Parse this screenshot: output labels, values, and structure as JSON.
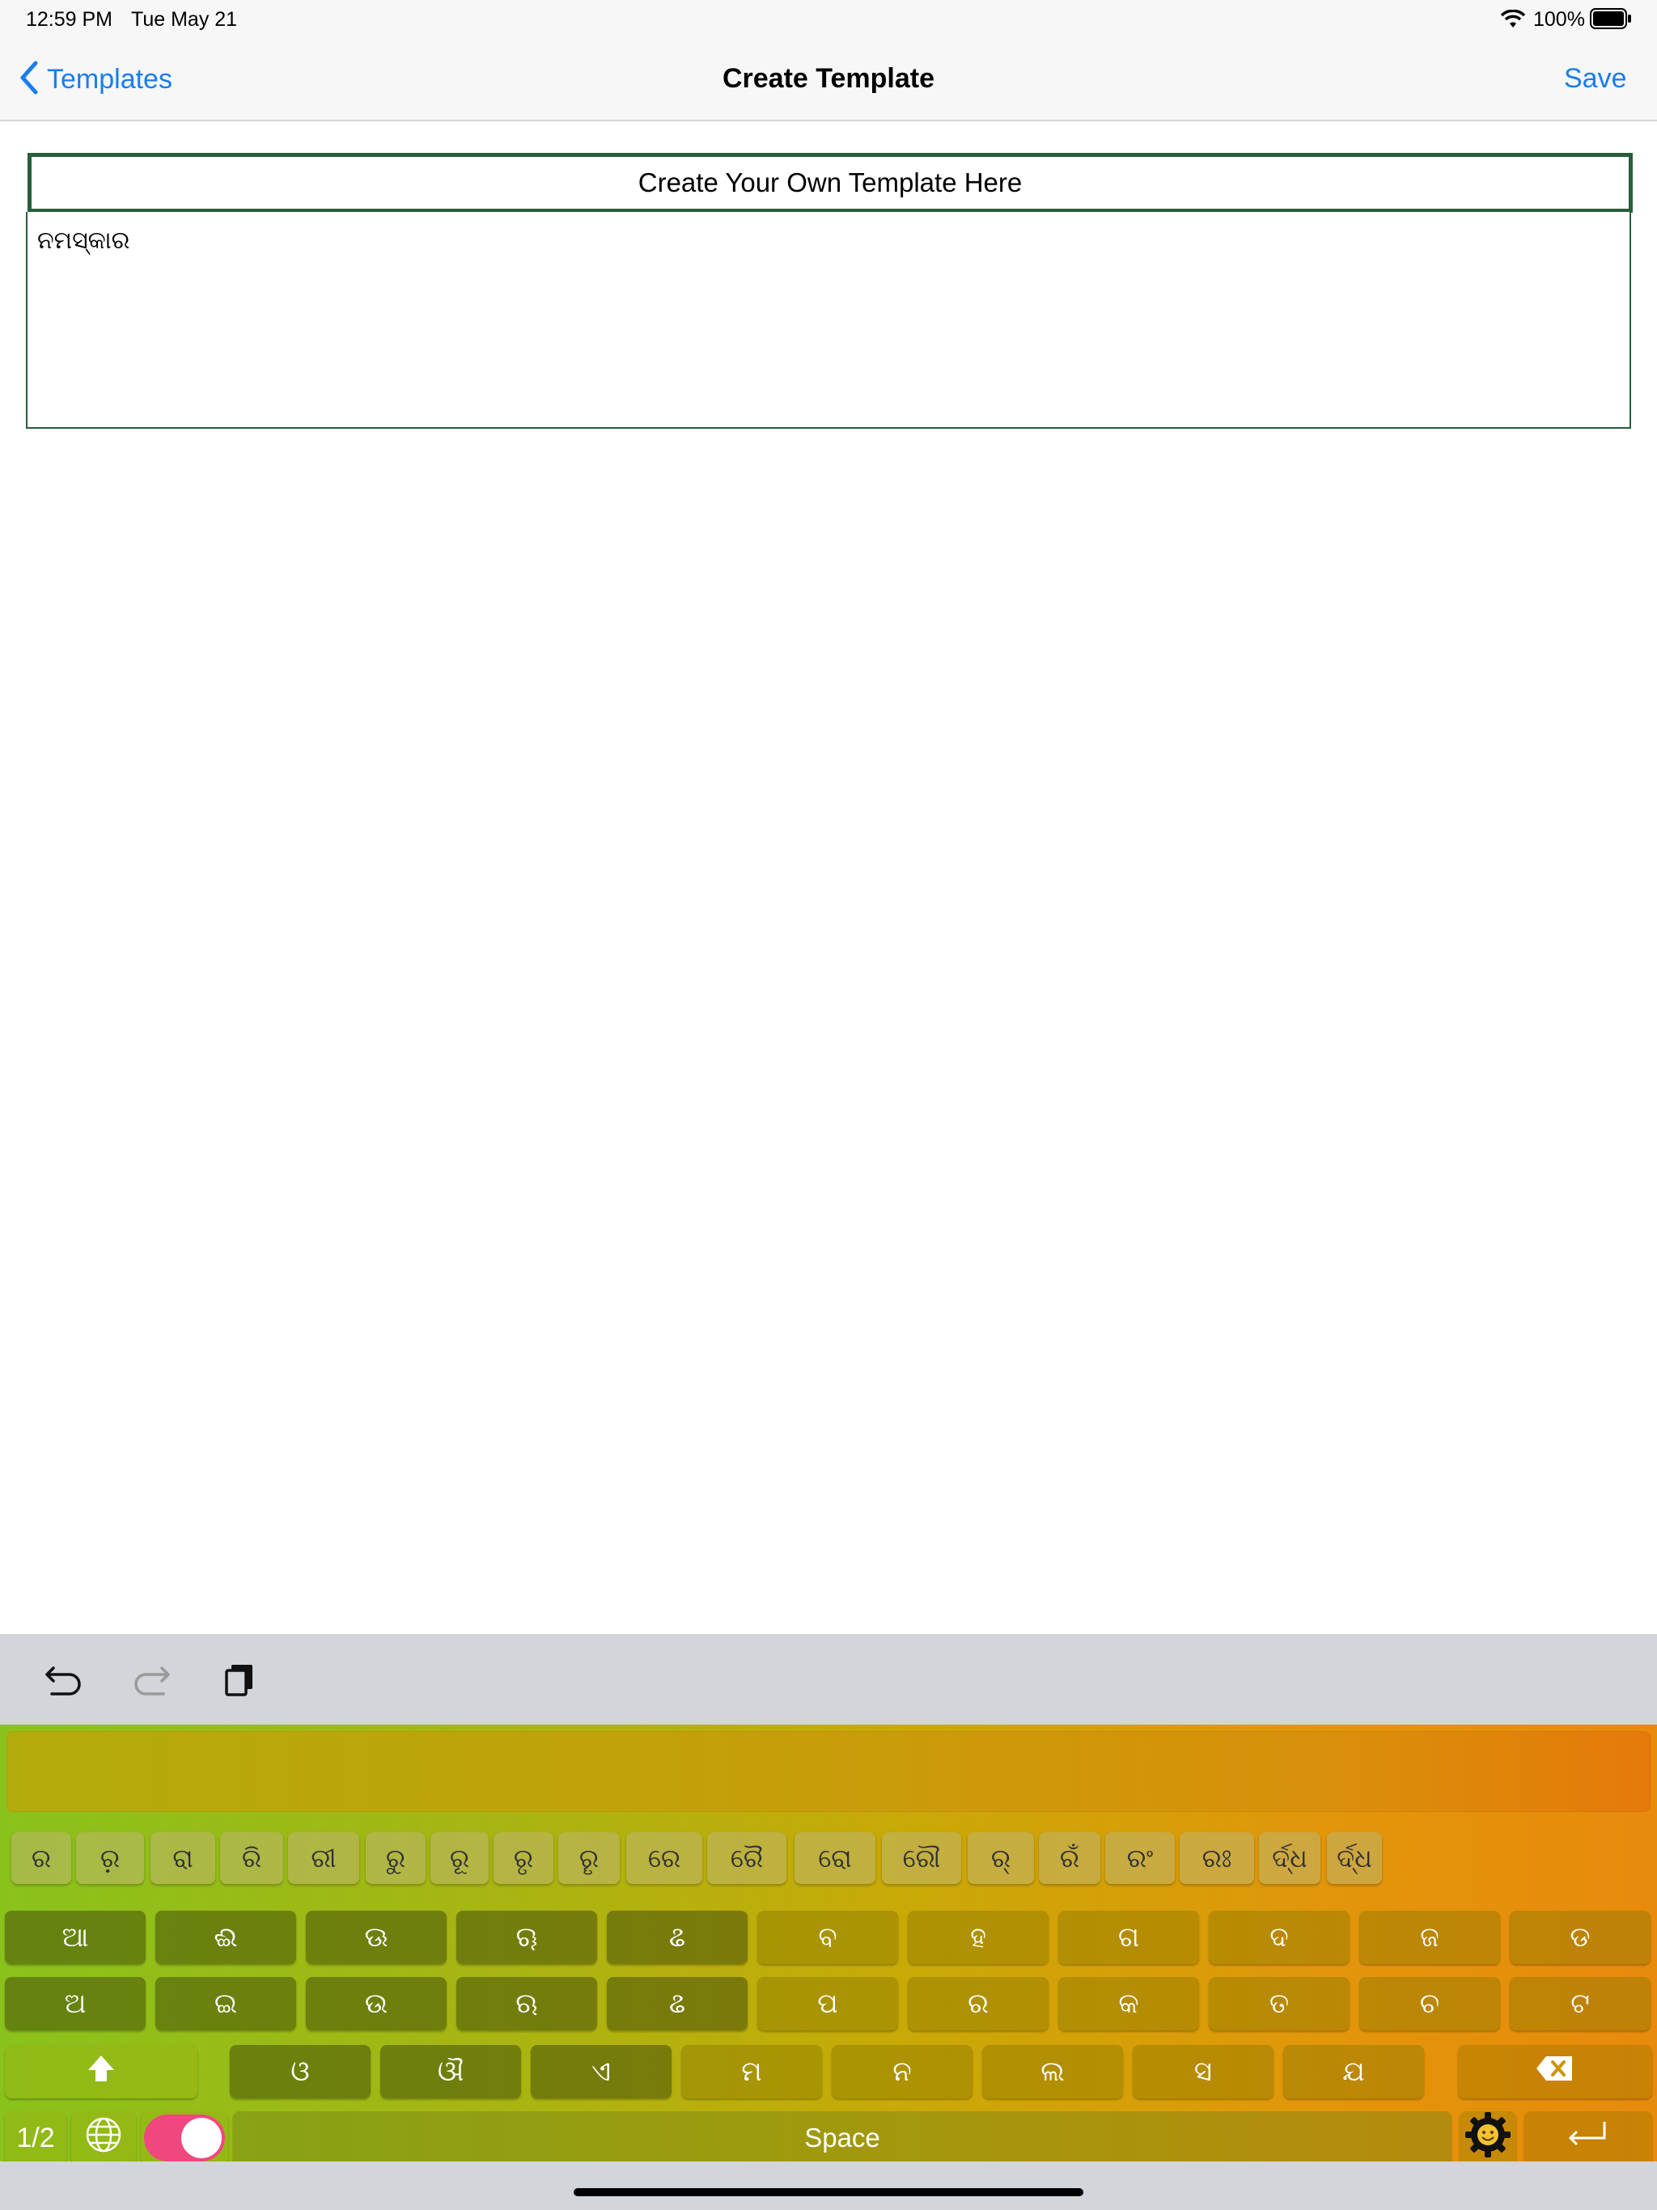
{
  "status": {
    "time": "12:59 PM",
    "date": "Tue May 21",
    "battery": "100%"
  },
  "nav": {
    "back_label": "Templates",
    "title": "Create Template",
    "save_label": "Save"
  },
  "template": {
    "title_placeholder": "Create Your Own Template Here",
    "body_text": "ନମସ୍କାର"
  },
  "toolbar": {
    "icons": [
      "undo-icon",
      "redo-icon",
      "paste-icon"
    ]
  },
  "keyboard": {
    "vowel_sign_row": [
      "ର",
      "ର଼",
      "ରା",
      "ରି",
      "ରୀ",
      "ରୁ",
      "ରୂ",
      "ରୃ",
      "ରୄ",
      "ରେ",
      "ରୈ",
      "ରୋ",
      "ରୌ",
      "ର୍",
      "ରଁ",
      "ରଂ",
      "ରଃ",
      "ର୍ଦ୍ଧ",
      "ର୍ଦ୍ଧ"
    ],
    "row1": [
      "ଆ",
      "ଈ",
      "ଊ",
      "ୠ",
      "ଌ",
      "ବ",
      "ହ",
      "ଗ",
      "ଦ",
      "ଜ",
      "ଡ"
    ],
    "row2": [
      "ଅ",
      "ଇ",
      "ଉ",
      "ଋ",
      "ଌ",
      "ପ",
      "ର",
      "କ",
      "ତ",
      "ଚ",
      "ଟ"
    ],
    "row3": [
      "ଓ",
      "ଔ",
      "ଏ",
      "ମ",
      "ନ",
      "ଲ",
      "ସ",
      "ଯ"
    ],
    "page_label": "1/2",
    "space_label": "Space"
  }
}
